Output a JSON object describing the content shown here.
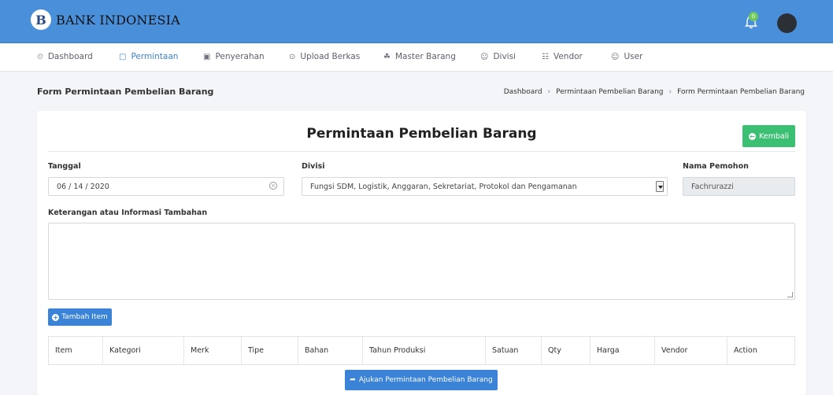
{
  "header": {
    "logo_letter": "B",
    "brand": "BANK INDONESIA",
    "notification_count": "0"
  },
  "nav": [
    {
      "label": "Dashboard",
      "icon": "dashboard-icon",
      "glyph": "⏲"
    },
    {
      "label": "Permintaan",
      "icon": "clipboard-icon",
      "glyph": "▢"
    },
    {
      "label": "Penyerahan",
      "icon": "tray-icon",
      "glyph": "▣"
    },
    {
      "label": "Upload Berkas",
      "icon": "upload-icon",
      "glyph": "⊙"
    },
    {
      "label": "Master Barang",
      "icon": "box-icon",
      "glyph": "☘"
    },
    {
      "label": "Divisi",
      "icon": "users-icon",
      "glyph": "☺"
    },
    {
      "label": "Vendor",
      "icon": "store-icon",
      "glyph": "☷"
    },
    {
      "label": "User",
      "icon": "user-icon",
      "glyph": "☺"
    }
  ],
  "page": {
    "title": "Form Permintaan Pembelian Barang",
    "breadcrumb": [
      "Dashboard",
      "Permintaan Pembelian Barang",
      "Form Permintaan Pembelian Barang"
    ]
  },
  "form": {
    "heading": "Permintaan Pembelian Barang",
    "back_label": "Kembali",
    "tanggal_label": "Tanggal",
    "tanggal_value": "06 / 14 / 2020",
    "divisi_label": "Divisi",
    "divisi_value": "Fungsi SDM, Logistik, Anggaran, Sekretariat, Protokol dan Pengamanan",
    "pemohon_label": "Nama Pemohon",
    "pemohon_value": "Fachrurazzi",
    "keterangan_label": "Keterangan atau Informasi Tambahan",
    "keterangan_value": "",
    "add_item_label": "Tambah Item",
    "submit_label": "Ajukan Permintaan Pembelian Barang"
  },
  "table": {
    "columns": [
      "Item",
      "Kategori",
      "Merk",
      "Tipe",
      "Bahan",
      "Tahun Produksi",
      "Satuan",
      "Qty",
      "Harga",
      "Vendor",
      "Action"
    ]
  },
  "colors": {
    "header_bg": "#4a8fd9",
    "primary": "#3a83d6",
    "success": "#3bbf72"
  }
}
